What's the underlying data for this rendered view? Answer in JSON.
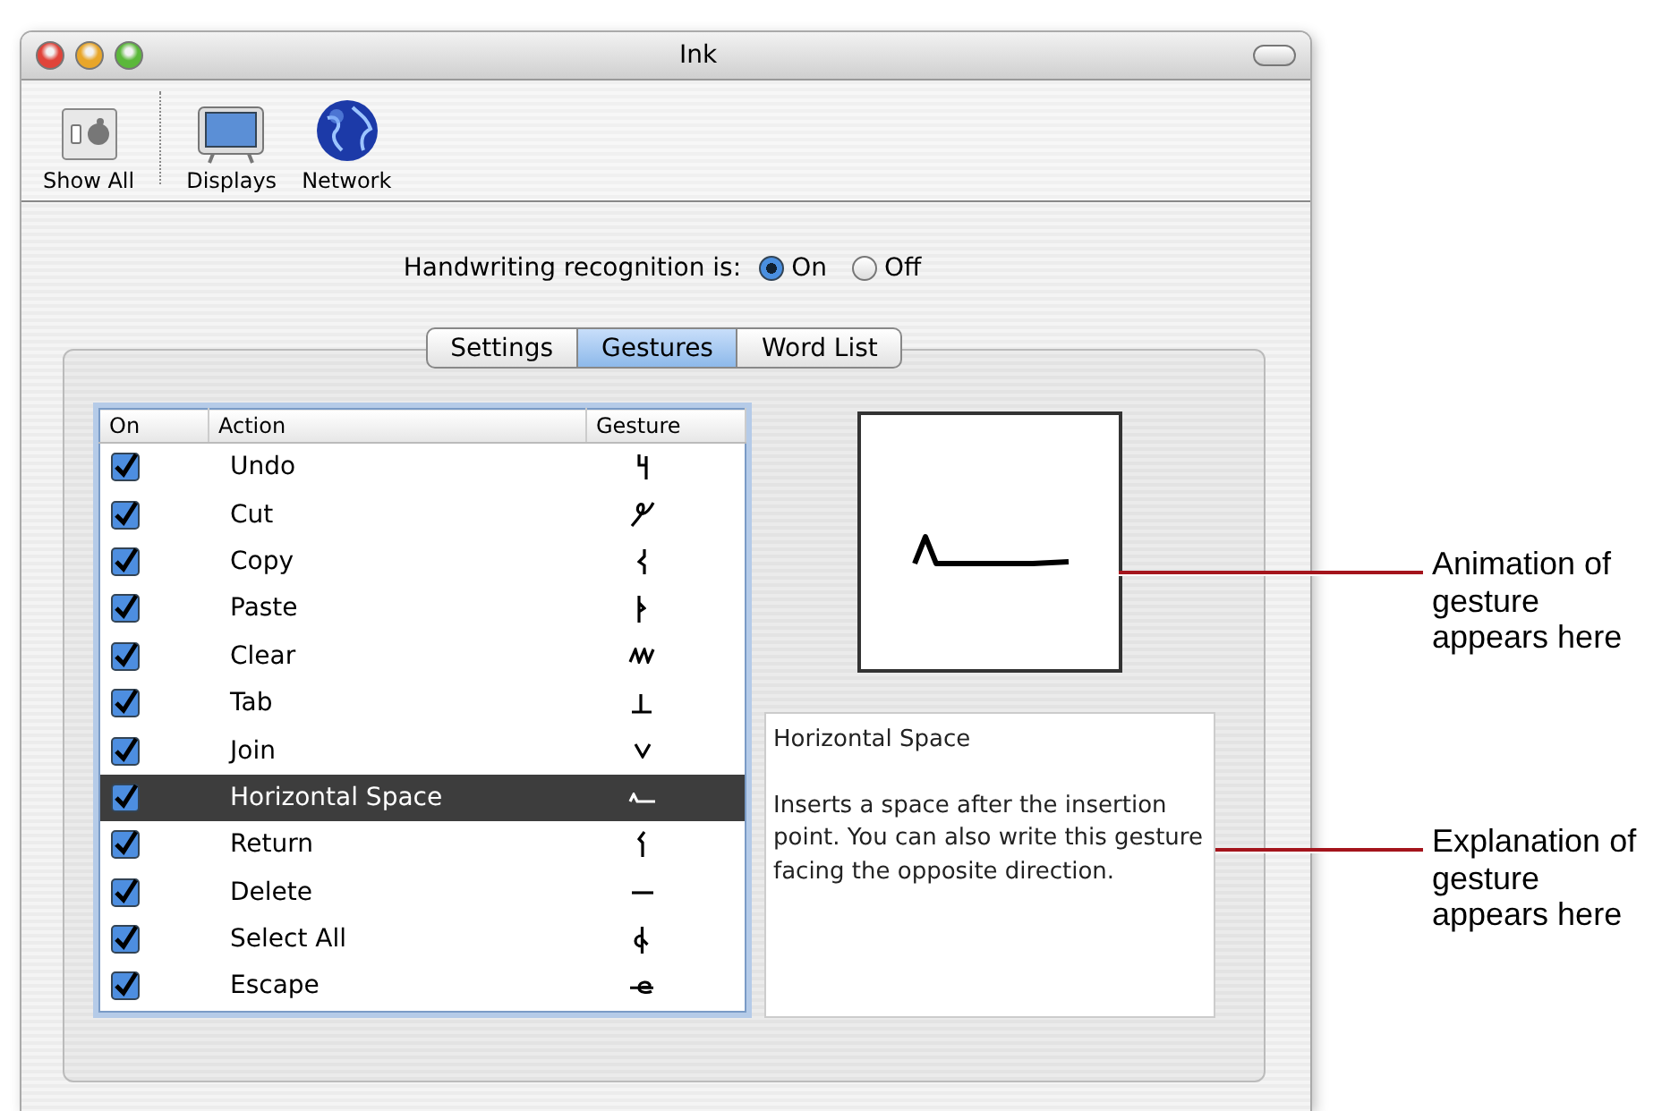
{
  "window": {
    "title": "Ink"
  },
  "toolbar": [
    {
      "label": "Show All",
      "kind": "show-all"
    },
    {
      "label": "Displays",
      "kind": "displays"
    },
    {
      "label": "Network",
      "kind": "network"
    }
  ],
  "recognition": {
    "label": "Handwriting recognition is:",
    "options": [
      {
        "label": "On",
        "selected": true
      },
      {
        "label": "Off",
        "selected": false
      }
    ]
  },
  "tabs": [
    {
      "label": "Settings",
      "selected": false
    },
    {
      "label": "Gestures",
      "selected": true
    },
    {
      "label": "Word List",
      "selected": false
    }
  ],
  "table": {
    "columns": [
      "On",
      "Action",
      "Gesture"
    ],
    "rows": [
      {
        "action": "Undo",
        "checked": true,
        "selected": false
      },
      {
        "action": "Cut",
        "checked": true,
        "selected": false
      },
      {
        "action": "Copy",
        "checked": true,
        "selected": false
      },
      {
        "action": "Paste",
        "checked": true,
        "selected": false
      },
      {
        "action": "Clear",
        "checked": true,
        "selected": false
      },
      {
        "action": "Tab",
        "checked": true,
        "selected": false
      },
      {
        "action": "Join",
        "checked": true,
        "selected": false
      },
      {
        "action": "Horizontal Space",
        "checked": true,
        "selected": true
      },
      {
        "action": "Return",
        "checked": true,
        "selected": false
      },
      {
        "action": "Delete",
        "checked": true,
        "selected": false
      },
      {
        "action": "Select All",
        "checked": true,
        "selected": false
      },
      {
        "action": "Escape",
        "checked": true,
        "selected": false
      }
    ]
  },
  "description": {
    "title": "Horizontal Space",
    "text": "Inserts a space after the insertion point. You can also write this gesture facing the opposite direction."
  },
  "callouts": [
    "Animation of gesture appears here",
    "Explanation of gesture appears here"
  ]
}
